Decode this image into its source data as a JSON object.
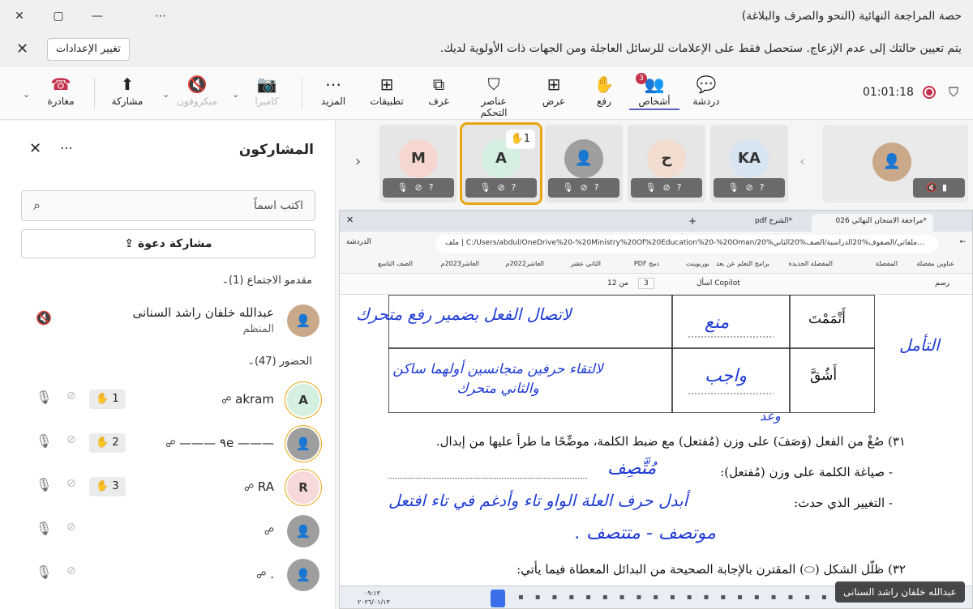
{
  "window": {
    "title": "حصة المراجعة النهائية (النحو والصرف والبلاغة)",
    "controls": [
      "✕",
      "▢",
      "—",
      "⋯"
    ]
  },
  "notification": {
    "text": "يتم تعيين حالتك إلى عدم الإزعاج. ستحصل فقط على الإعلامات للرسائل العاجلة ومن الجهات ذات الأولوية لديك.",
    "button": "تغيير الإعدادات"
  },
  "toolbar": {
    "timer": "01:01:18",
    "items": {
      "chat": "دردشة",
      "people": "أشخاص",
      "people_badge": "3",
      "raise": "رفع",
      "view": "عرض",
      "controls": "عناصر التحكم",
      "rooms": "غرف",
      "apps": "تطبيقات",
      "more": "المزيد",
      "camera": "كاميرا",
      "mic": "ميكروفون",
      "share": "مشاركة",
      "leave": "مغادرة"
    }
  },
  "panel": {
    "title": "المشاركون",
    "search_placeholder": "اكتب اسماً",
    "invite": "مشاركة دعوة",
    "organizers_header": "مقدمو الاجتماع (1)",
    "organizer": {
      "name": "عبدالله خلفان راشد السنانى",
      "role": "المنظم"
    },
    "attendees_header": "الحضور (47)",
    "attendees": [
      {
        "name": "akram",
        "initial": "A",
        "hand": "1",
        "color": "#d5efe0"
      },
      {
        "name": "——— ٩e ———",
        "initial": "",
        "hand": "2",
        "color": "#9e9e9e"
      },
      {
        "name": "RA",
        "initial": "R",
        "hand": "3",
        "color": "#f7d9d9"
      },
      {
        "name": "",
        "initial": "",
        "hand": "",
        "color": "#9e9e9e"
      },
      {
        "name": ".",
        "initial": "",
        "hand": "",
        "color": "#9e9e9e"
      }
    ]
  },
  "strip": {
    "tiles": [
      {
        "initial": "M",
        "color": "#f6d7cf",
        "hand": ""
      },
      {
        "initial": "A",
        "color": "#d5efe0",
        "hand": "1"
      },
      {
        "initial": "",
        "color": "#9e9e9e",
        "hand": ""
      },
      {
        "initial": "ح",
        "color": "#f2ddd0",
        "hand": ""
      },
      {
        "initial": "KA",
        "color": "#d7e4f2",
        "hand": ""
      }
    ]
  },
  "screen": {
    "tabs": [
      "*مراجعة الامتحان النهائي 026",
      "*الشرح pdf"
    ],
    "address": "C:/Users/abdul/OneDrive%20-%20Ministry%20Of%20Education%20-%20Oman/ملفاتي/الصفوف%20الدراسية/الصف%20الثاني%20...",
    "address_label": "ملف",
    "chat_label": "الدردشة",
    "bookmarks": [
      "عناوين مفضلة",
      "المفضلة",
      "المفضلة الجديدة",
      "برامج التعلم عن بعد",
      "بوربوينت",
      "دمج PDF",
      "الثاني عشر",
      "العاشر2022م",
      "العاشر2023م",
      "الصف التاسع"
    ],
    "pdf": {
      "page": "3",
      "of": "من 12",
      "copilot": "اسأل Copilot",
      "draw": "رسم"
    },
    "table_rows": [
      {
        "word": "أَتْمَمْتَ",
        "ruling": "منع",
        "reason": "لاتصال الفعل بضمير رفع متحرك"
      },
      {
        "word": "أَشُقَّ",
        "ruling": "واجب",
        "reason": "لالتقاء حرفين متجانسين أولهما ساكن والثاني متحرك"
      }
    ],
    "side_note": "التأمل",
    "q31": "٣١) صُغْ من الفعل (وَصَفَ) على وزن (مُفتعل) مع ضبط الكلمة، موضِّحًا ما طرأ عليها من إبدال.",
    "q31_a": "- صياغة الكلمة على وزن (مُفتعل):",
    "q31_a_hw": "مُتَّصِف",
    "q31_b": "- التغيير الذي حدث:",
    "q31_b_hw": "أبدل حرف العلة الواو تاء وأدغم في تاء افتعل",
    "q31_c_hw": "موتصف - متتصف .",
    "q31_top_hw": "وعد",
    "q32": "٣٢) ظلّل الشكل (⬭) المقترن بالإجابة الصحيحة من البدائل المعطاة فيما يأتي:",
    "taskbar_time": "٠٩:١٣",
    "taskbar_date": "٢٠٢٦/٠١/١٣"
  },
  "speaker": "عبدالله خلفان راشد السنانى"
}
